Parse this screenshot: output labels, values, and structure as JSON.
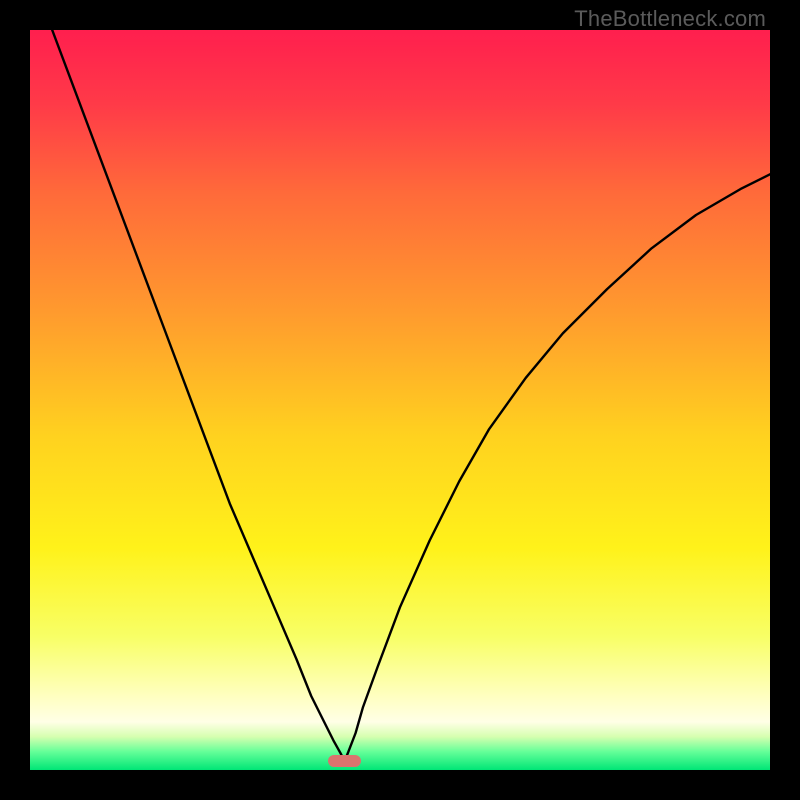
{
  "watermark": "TheBottleneck.com",
  "colors": {
    "frame_bg": "#000000",
    "curve": "#000000",
    "marker": "#d9736e"
  },
  "gradient_stops": [
    {
      "offset": 0.0,
      "color": "#ff1f4e"
    },
    {
      "offset": 0.1,
      "color": "#ff3a48"
    },
    {
      "offset": 0.22,
      "color": "#ff6a3a"
    },
    {
      "offset": 0.38,
      "color": "#ff9a2e"
    },
    {
      "offset": 0.55,
      "color": "#ffd21f"
    },
    {
      "offset": 0.7,
      "color": "#fff21a"
    },
    {
      "offset": 0.82,
      "color": "#f8ff66"
    },
    {
      "offset": 0.9,
      "color": "#ffffc0"
    },
    {
      "offset": 0.935,
      "color": "#ffffe6"
    },
    {
      "offset": 0.955,
      "color": "#d6ffb0"
    },
    {
      "offset": 0.975,
      "color": "#66ff99"
    },
    {
      "offset": 1.0,
      "color": "#00e676"
    }
  ],
  "chart_data": {
    "type": "line",
    "title": "",
    "xlabel": "",
    "ylabel": "",
    "xlim": [
      0,
      100
    ],
    "ylim": [
      0,
      100
    ],
    "optimum_x": 42.5,
    "marker": {
      "x": 42.5,
      "y": 1.2,
      "width": 4.5,
      "height": 1.6
    },
    "series": [
      {
        "name": "bottleneck-curve",
        "x": [
          0,
          3,
          6,
          9,
          12,
          15,
          18,
          21,
          24,
          27,
          30,
          33,
          36,
          38,
          40,
          41,
          42,
          42.5,
          43,
          44,
          45,
          47,
          50,
          54,
          58,
          62,
          67,
          72,
          78,
          84,
          90,
          96,
          100
        ],
        "y": [
          108,
          100,
          92,
          84,
          76,
          68,
          60,
          52,
          44,
          36,
          29,
          22,
          15,
          10,
          6,
          4,
          2.2,
          1.2,
          2.4,
          5,
          8.5,
          14,
          22,
          31,
          39,
          46,
          53,
          59,
          65,
          70.5,
          75,
          78.5,
          80.5
        ]
      }
    ]
  }
}
